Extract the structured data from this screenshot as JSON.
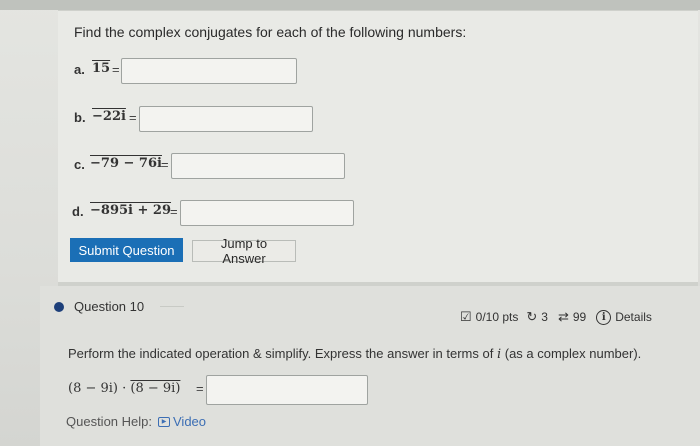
{
  "question": {
    "prompt": "Find the complex conjugates for each of the following numbers:",
    "parts": [
      {
        "label": "a.",
        "expression": "15",
        "eq": "=",
        "value": ""
      },
      {
        "label": "b.",
        "expression": "−22i",
        "eq": "=",
        "value": ""
      },
      {
        "label": "c.",
        "expression": "−79 − 76i",
        "eq": "=",
        "value": ""
      },
      {
        "label": "d.",
        "expression": "−895i + 29",
        "eq": "=",
        "value": ""
      }
    ],
    "submit_label": "Submit Question",
    "jump_label": "Jump to Answer"
  },
  "next_question": {
    "title": "Question 10",
    "points": "0/10 pts",
    "attempts": "3",
    "retries": "99",
    "details_label": "Details",
    "instruction_prefix": "Perform the indicated operation & simplify. Express the answer in terms of ",
    "instruction_var": "i",
    "instruction_suffix": " (as a complex number).",
    "expr_left": "(8 − 9i) · ",
    "expr_right": "(8 − 9i)",
    "eq": "=",
    "value": "",
    "help_label": "Question Help:",
    "video_label": "Video"
  },
  "colors": {
    "primary_button": "#1b6fb6",
    "bullet": "#1d3f7a",
    "link": "#3c6eb4"
  }
}
